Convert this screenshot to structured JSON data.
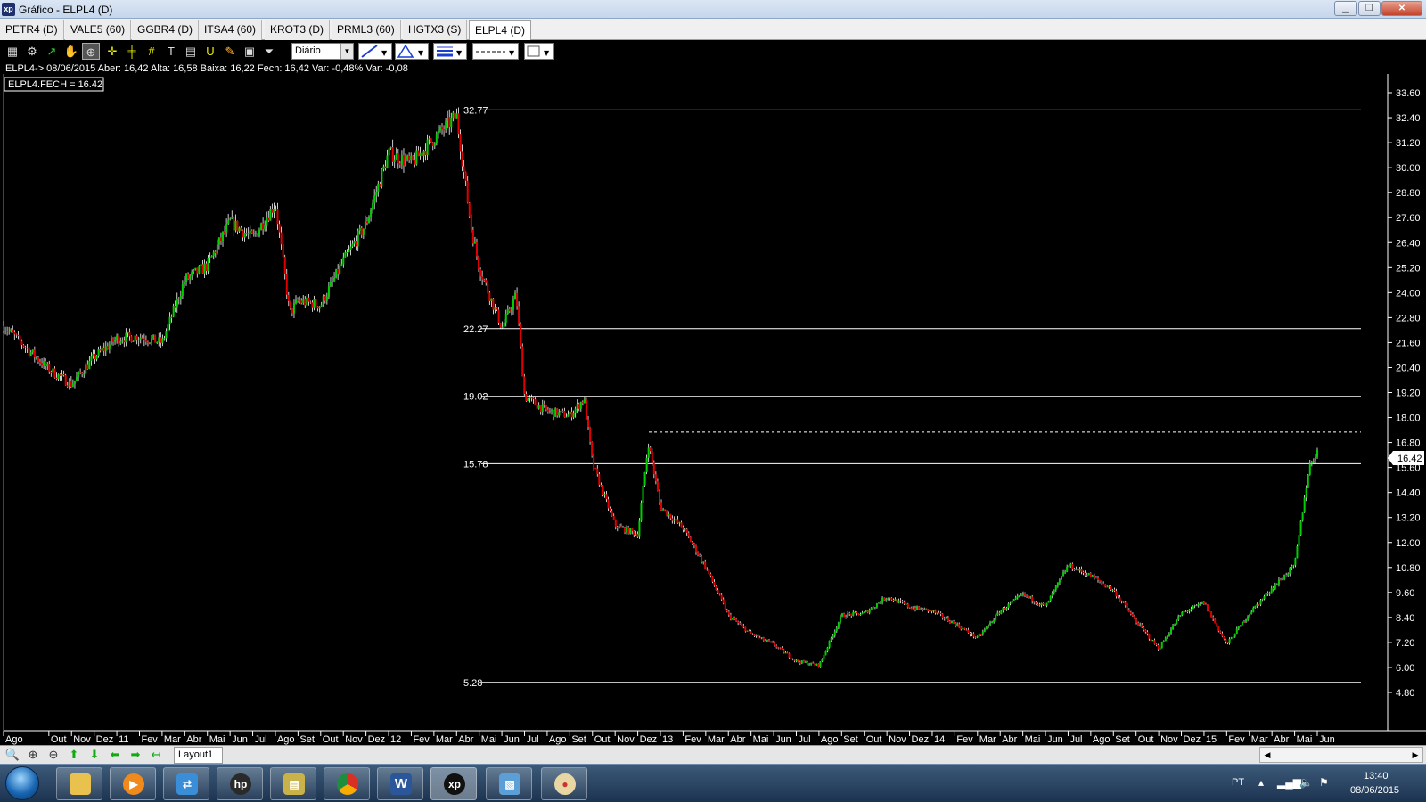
{
  "window": {
    "title": "Gráfico - ELPL4 (D)",
    "app_icon": "xp",
    "controls": [
      "minimize-icon",
      "restore-icon",
      "close-icon"
    ]
  },
  "tabs": [
    {
      "label": "PETR4 (D)",
      "active": false
    },
    {
      "label": "VALE5 (60)",
      "active": false
    },
    {
      "label": "GGBR4 (D)",
      "active": false
    },
    {
      "label": "ITSA4 (60)",
      "active": false
    },
    {
      "label": "KROT3 (D)",
      "active": false
    },
    {
      "label": "PRML3 (60)",
      "active": false
    },
    {
      "label": "HGTX3 (S)",
      "active": false
    },
    {
      "label": "ELPL4 (D)",
      "active": true
    }
  ],
  "toolbar": {
    "icons": [
      "chart-type-icon",
      "settings-icon",
      "indicator-icon",
      "pan-hand-icon",
      "zoom-select-icon",
      "crosshair-icon",
      "cross-parallel-icon",
      "grid-icon",
      "text-tool-icon",
      "magnet-icon",
      "calculator-icon",
      "brush-icon",
      "clipboard-icon",
      "filter-icon"
    ],
    "period": "Diário"
  },
  "info": {
    "ohlc": "ELPL4-> 08/06/2015 Aber: 16,42 Alta: 16,58 Baixa: 16,22 Fech: 16,42 Var: -0,48% Var: -0,08",
    "legend": "ELPL4.FECH = 16.42"
  },
  "chart_data": {
    "type": "candlestick",
    "symbol": "ELPL4",
    "last_price": "16.42",
    "ylim": [
      4.8,
      33.6
    ],
    "yticks": [
      "33.60",
      "32.40",
      "31.20",
      "30.00",
      "28.80",
      "27.60",
      "26.40",
      "25.20",
      "24.00",
      "22.80",
      "21.60",
      "20.40",
      "19.20",
      "18.00",
      "16.80",
      "15.60",
      "14.40",
      "13.20",
      "12.00",
      "10.80",
      "9.60",
      "8.40",
      "7.20",
      "6.00",
      "4.80"
    ],
    "hlines": [
      {
        "value": 32.77,
        "label": "32.77",
        "style": "solid"
      },
      {
        "value": 22.27,
        "label": "22.27",
        "style": "solid"
      },
      {
        "value": 19.02,
        "label": "19.02",
        "style": "solid"
      },
      {
        "value": 15.78,
        "label": "15.78",
        "style": "solid"
      },
      {
        "value": 5.28,
        "label": "5.28",
        "style": "solid"
      },
      {
        "value": 17.3,
        "label": "",
        "style": "dashed"
      }
    ],
    "xticks": [
      "Ago",
      "Out",
      "Nov",
      "Dez",
      "11",
      "Fev",
      "Mar",
      "Abr",
      "Mai",
      "Jun",
      "Jul",
      "Ago",
      "Set",
      "Out",
      "Nov",
      "Dez",
      "12",
      "Fev",
      "Mar",
      "Abr",
      "Mai",
      "Jun",
      "Jul",
      "Ago",
      "Set",
      "Out",
      "Nov",
      "Dez",
      "13",
      "Fev",
      "Mar",
      "Abr",
      "Mai",
      "Jun",
      "Jul",
      "Ago",
      "Set",
      "Out",
      "Nov",
      "Dez",
      "14",
      "Fev",
      "Mar",
      "Abr",
      "Mai",
      "Jun",
      "Jul",
      "Ago",
      "Set",
      "Out",
      "Nov",
      "Dez",
      "15",
      "Fev",
      "Mar",
      "Abr",
      "Mai",
      "Jun"
    ],
    "xrange": [
      "2010-08",
      "2015-06"
    ],
    "trend": [
      [
        "2010-08",
        22.4
      ],
      [
        "2010-10",
        20.3
      ],
      [
        "2010-11",
        19.6
      ],
      [
        "2010-12",
        20.9
      ],
      [
        "2011-01",
        21.8
      ],
      [
        "2011-02",
        21.9
      ],
      [
        "2011-03",
        21.6
      ],
      [
        "2011-04",
        24.6
      ],
      [
        "2011-05",
        25.3
      ],
      [
        "2011-06",
        27.4
      ],
      [
        "2011-07",
        26.6
      ],
      [
        "2011-08",
        28.3
      ],
      [
        "2011-08-20",
        23.0
      ],
      [
        "2011-09",
        23.6
      ],
      [
        "2011-10",
        23.4
      ],
      [
        "2011-11",
        25.5
      ],
      [
        "2011-12",
        27.3
      ],
      [
        "2012-01",
        30.7
      ],
      [
        "2012-02",
        30.2
      ],
      [
        "2012-03",
        31.4
      ],
      [
        "2012-04",
        32.5
      ],
      [
        "2012-04-20",
        27.2
      ],
      [
        "2012-05",
        25.2
      ],
      [
        "2012-06",
        22.3
      ],
      [
        "2012-06-20",
        23.9
      ],
      [
        "2012-07",
        19.0
      ],
      [
        "2012-08",
        18.3
      ],
      [
        "2012-09",
        18.1
      ],
      [
        "2012-09-20",
        18.9
      ],
      [
        "2012-10",
        15.8
      ],
      [
        "2012-11",
        12.8
      ],
      [
        "2012-12",
        12.4
      ],
      [
        "2012-12-15",
        16.8
      ],
      [
        "2013-01",
        13.7
      ],
      [
        "2013-02",
        12.7
      ],
      [
        "2013-03",
        10.8
      ],
      [
        "2013-04",
        8.5
      ],
      [
        "2013-05",
        7.6
      ],
      [
        "2013-06",
        7.1
      ],
      [
        "2013-07",
        6.3
      ],
      [
        "2013-08",
        6.1
      ],
      [
        "2013-09",
        8.5
      ],
      [
        "2013-10",
        8.6
      ],
      [
        "2013-11",
        9.4
      ],
      [
        "2013-12",
        8.9
      ],
      [
        "2014-01",
        8.7
      ],
      [
        "2014-02",
        8.1
      ],
      [
        "2014-03",
        7.4
      ],
      [
        "2014-04",
        8.7
      ],
      [
        "2014-05",
        9.5
      ],
      [
        "2014-06",
        8.9
      ],
      [
        "2014-07",
        10.9
      ],
      [
        "2014-08",
        10.4
      ],
      [
        "2014-09",
        9.7
      ],
      [
        "2014-10",
        8.2
      ],
      [
        "2014-11",
        6.9
      ],
      [
        "2014-12",
        8.6
      ],
      [
        "2015-01",
        9.1
      ],
      [
        "2015-02",
        7.1
      ],
      [
        "2015-03",
        8.6
      ],
      [
        "2015-04",
        9.8
      ],
      [
        "2015-05",
        10.9
      ],
      [
        "2015-05-20",
        15.6
      ],
      [
        "2015-06",
        16.42
      ]
    ],
    "grid": false,
    "background": "#000000",
    "up_color": "#00d000",
    "down_color": "#e00000"
  },
  "bottom": {
    "nav_icons": [
      "zoom-icon",
      "zoom-in-icon",
      "zoom-out-icon",
      "arrow-up-icon",
      "arrow-down-icon",
      "arrow-left-icon",
      "arrow-right-icon",
      "arrow-return-icon"
    ],
    "layout_tab": "Layout1"
  },
  "taskbar": {
    "apps": [
      "explorer",
      "media-player",
      "network",
      "hp",
      "toolbox",
      "chrome",
      "word",
      "xp",
      "photos",
      "paint"
    ],
    "word_label": "W",
    "xp_label": "xp",
    "hp_label": "hp",
    "language": "PT",
    "time": "13:40",
    "date": "08/06/2015"
  }
}
